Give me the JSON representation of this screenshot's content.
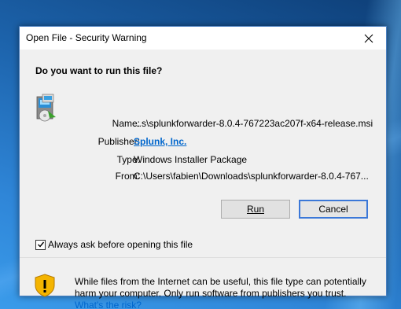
{
  "dialog": {
    "title": "Open File - Security Warning",
    "question": "Do you want to run this file?",
    "fields": {
      "name_label": "Name:",
      "name_value": "...s\\splunkforwarder-8.0.4-767223ac207f-x64-release.msi",
      "publisher_label": "Publisher:",
      "publisher_value": "Splunk, Inc.",
      "type_label": "Type:",
      "type_value": "Windows Installer Package",
      "from_label": "From:",
      "from_value": "C:\\Users\\fabien\\Downloads\\splunkforwarder-8.0.4-767..."
    },
    "buttons": {
      "run_label": "Run",
      "cancel_label": "Cancel"
    },
    "checkbox": {
      "label": "Always ask before opening this file",
      "checked": true
    },
    "footer": {
      "warning_text": "While files from the Internet can be useful, this file type can potentially harm your computer. Only run software from publishers you trust.",
      "risk_link": "What's the risk?"
    }
  },
  "icons": {
    "close": "close-icon",
    "file": "installer-file-icon",
    "warning": "security-shield-icon",
    "check": "checkmark-icon"
  }
}
